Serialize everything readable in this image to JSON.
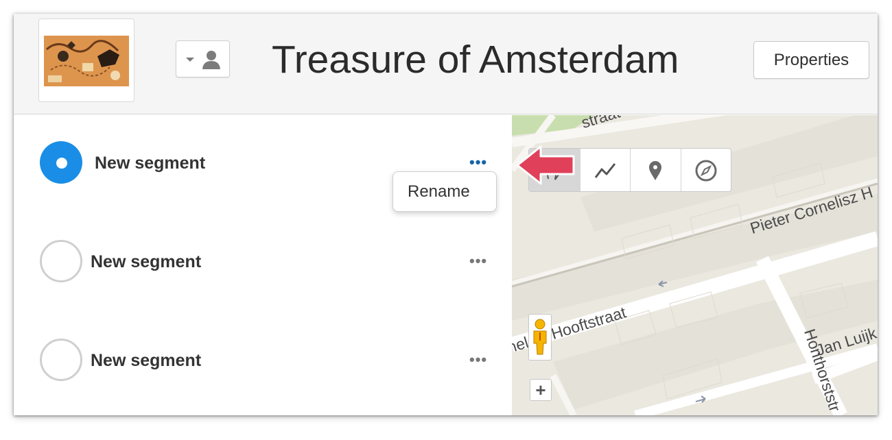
{
  "header": {
    "title": "Treasure of Amsterdam",
    "properties_label": "Properties",
    "thumbnail_icon": "treasure-map-thumbnail",
    "owner_icon": "person-icon"
  },
  "segments": [
    {
      "label": "New segment",
      "selected": true,
      "more": "•••"
    },
    {
      "label": "New segment",
      "selected": false,
      "more": "•••"
    },
    {
      "label": "New segment",
      "selected": false,
      "more": "•••"
    }
  ],
  "menu": {
    "rename_label": "Rename"
  },
  "map": {
    "streets": [
      "straat",
      "Pieter Cornelisz H",
      "nel",
      "Hooftstraat",
      "Honthorststr",
      "Jan Luijk"
    ],
    "tools": [
      "hand-icon",
      "line-icon",
      "pin-icon",
      "compass-icon"
    ],
    "zoom_in_label": "+"
  },
  "colors": {
    "accent": "#1a8ee6",
    "active_more": "#1664a8",
    "callout_arrow": "#e0405a"
  }
}
